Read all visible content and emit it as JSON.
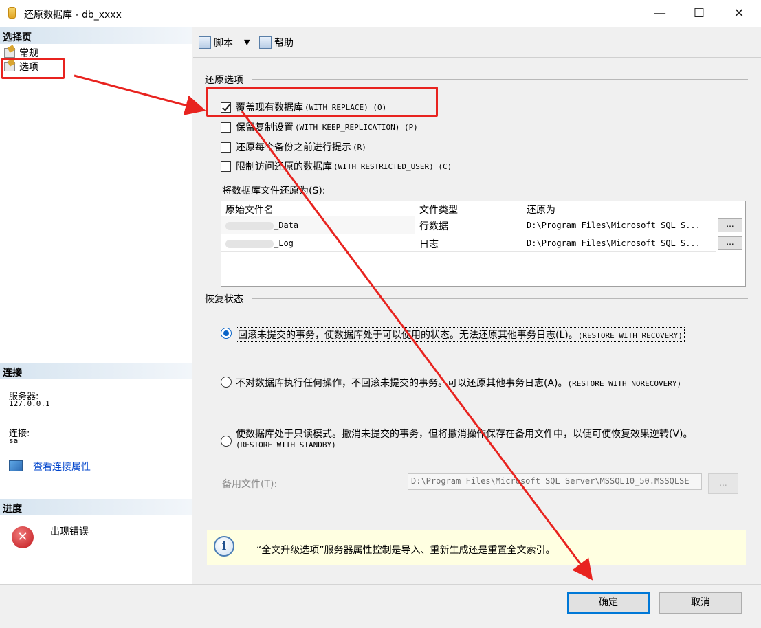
{
  "window": {
    "title": "还原数据库 - db_xxxx",
    "minimize": "—",
    "maximize": "☐",
    "close": "✕"
  },
  "left_panel": {
    "select_page_header": "选择页",
    "nav_items": [
      "常规",
      "选项"
    ],
    "connection_header": "连接",
    "server_label": "服务器:",
    "server_value": "127.0.0.1",
    "connection_label": "连接:",
    "connection_value": "sa",
    "view_connection_link": "查看连接属性",
    "progress_header": "进度",
    "progress_status": "出现错误"
  },
  "toolbar": {
    "script_label": "脚本",
    "script_dropdown": "▼",
    "help_label": "帮助"
  },
  "restore_options": {
    "group_title": "还原选项",
    "options": [
      {
        "label": "覆盖现有数据库",
        "en": "(WITH REPLACE) (O)",
        "checked": true
      },
      {
        "label": "保留复制设置",
        "en": "(WITH KEEP_REPLICATION) (P)",
        "checked": false
      },
      {
        "label": "还原每个备份之前进行提示",
        "en": "(R)",
        "checked": false
      },
      {
        "label": "限制访问还原的数据库",
        "en": "(WITH RESTRICTED_USER) (C)",
        "checked": false
      }
    ]
  },
  "restore_files": {
    "label": "将数据库文件还原为(S):",
    "columns": [
      "原始文件名",
      "文件类型",
      "还原为"
    ],
    "rows": [
      {
        "name_suffix": "_Data",
        "type": "行数据",
        "restore_as": "D:\\Program Files\\Microsoft SQL S...",
        "button": "..."
      },
      {
        "name_suffix": "_Log",
        "type": "日志",
        "restore_as": "D:\\Program Files\\Microsoft SQL S...",
        "button": "..."
      }
    ]
  },
  "recovery_state": {
    "group_title": "恢复状态",
    "options": [
      {
        "label": "回滚未提交的事务，使数据库处于可以使用的状态。无法还原其他事务日志(L)。",
        "en": "(RESTORE WITH RECOVERY)",
        "selected": true
      },
      {
        "label": "不对数据库执行任何操作，不回滚未提交的事务。可以还原其他事务日志(A)。",
        "en": "(RESTORE WITH NORECOVERY)",
        "selected": false
      },
      {
        "label": "使数据库处于只读模式。撤消未提交的事务，但将撤消操作保存在备用文件中，以便可使恢复效果逆转(V)。",
        "en": "(RESTORE WITH STANDBY)",
        "selected": false
      }
    ],
    "standby_label": "备用文件(T):",
    "standby_value": "D:\\Program Files\\Microsoft SQL Server\\MSSQL10_50.MSSQLSE",
    "standby_button": "..."
  },
  "info": {
    "icon_glyph": "i",
    "text": "“全文升级选项”服务器属性控制是导入、重新生成还是重置全文索引。"
  },
  "buttons": {
    "ok": "确定",
    "cancel": "取消"
  },
  "annotation_color": "#e8231f"
}
